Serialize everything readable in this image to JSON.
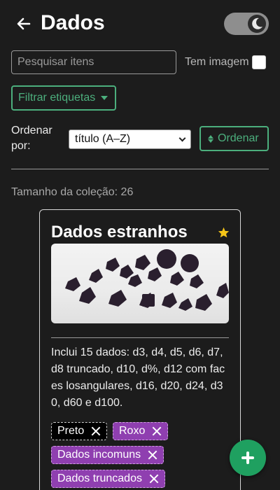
{
  "header": {
    "title": "Dados",
    "back_icon": "arrow-left-icon",
    "theme_toggle_icon": "moon-icon"
  },
  "filters": {
    "search_placeholder": "Pesquisar itens",
    "search_value": "",
    "has_image_label": "Tem imagem",
    "has_image_checked": false,
    "filter_tags_label": "Filtrar etiquetas"
  },
  "sort": {
    "label": "Ordenar por:",
    "selected": "título (A–Z)",
    "button_label": "Ordenar"
  },
  "collection": {
    "size_text": "Tamanho da coleção: 26"
  },
  "card": {
    "title": "Dados estranhos",
    "favorite": true,
    "description": "Inclui 15 dados: d3, d4, d5, d6, d7, d8 truncado, d10, d%, d12 com faces losangulares, d16, d20, d24, d30, d60 e d100.",
    "tags": [
      {
        "label": "Preto",
        "color": "#000000"
      },
      {
        "label": "Roxo",
        "color": "#8f3fb0"
      },
      {
        "label": "Dados incomuns",
        "color": "#8f3fb0"
      },
      {
        "label": "Dados truncados",
        "color": "#8f3fb0"
      }
    ]
  },
  "colors": {
    "accent": "#4caf7d",
    "fab": "#1fa060",
    "star": "#f5c518",
    "background": "#1c1c1c"
  }
}
